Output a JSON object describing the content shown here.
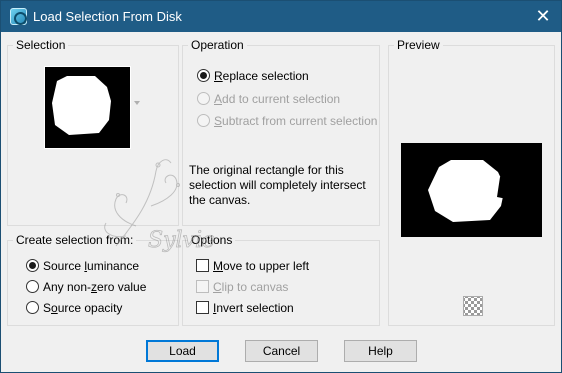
{
  "window": {
    "title": "Load Selection From Disk"
  },
  "selection_group": {
    "label": "Selection"
  },
  "operation_group": {
    "label": "Operation",
    "options": [
      {
        "pre": "",
        "key": "R",
        "post": "eplace selection",
        "checked": true,
        "enabled": true
      },
      {
        "pre": "",
        "key": "A",
        "post": "dd to current selection",
        "checked": false,
        "enabled": false
      },
      {
        "pre": "",
        "key": "S",
        "post": "ubtract from current selection",
        "checked": false,
        "enabled": false
      }
    ],
    "description": "The original rectangle for this selection will completely intersect the canvas."
  },
  "preview_group": {
    "label": "Preview"
  },
  "create_group": {
    "label": "Create selection from:",
    "options": [
      {
        "pre": "Source ",
        "key": "l",
        "post": "uminance",
        "checked": true
      },
      {
        "pre": "Any non-",
        "key": "z",
        "post": "ero value",
        "checked": false
      },
      {
        "pre": "S",
        "key": "o",
        "post": "urce opacity",
        "checked": false
      }
    ]
  },
  "options_group": {
    "label": "Options",
    "options": [
      {
        "pre": "",
        "key": "M",
        "post": "ove to upper left",
        "checked": false,
        "enabled": true
      },
      {
        "pre": "",
        "key": "C",
        "post": "lip to canvas",
        "checked": false,
        "enabled": false
      },
      {
        "pre": "",
        "key": "I",
        "post": "nvert selection",
        "checked": false,
        "enabled": true
      }
    ]
  },
  "buttons": {
    "load": "Load",
    "cancel": "Cancel",
    "help": "Help"
  },
  "watermark_text": "Sylvie"
}
